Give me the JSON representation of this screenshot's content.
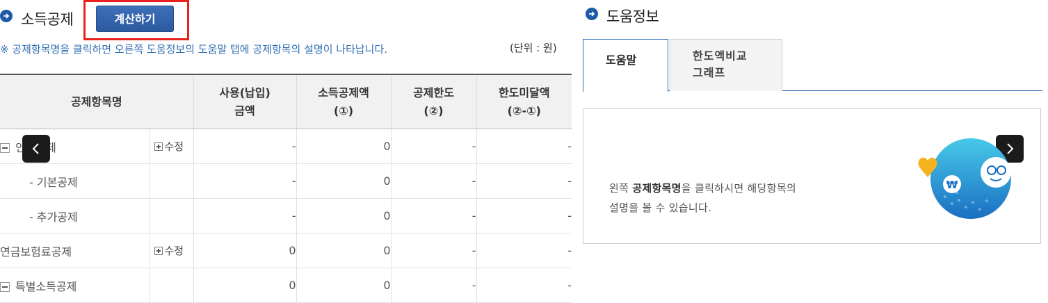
{
  "left": {
    "title": "소득공제",
    "calc_button": "계산하기",
    "notice": "※ 공제항목명을 클릭하면 오른쪽 도움정보의 도움말 탭에 공제항목의 설명이 나타납니다.",
    "unit": "(단위 : 원)",
    "table": {
      "headers": [
        "공제항목명",
        "사용(납입)\n금액",
        "소득공제액\n(①)",
        "공제한도\n(②)",
        "한도미달액\n(②-①)"
      ],
      "rows": [
        {
          "name": "인적공제",
          "edit": "수정",
          "used": "-",
          "deduct": "0",
          "limit": "-",
          "short": "-"
        },
        {
          "name": "- 기본공제",
          "edit": "",
          "used": "-",
          "deduct": "0",
          "limit": "-",
          "short": "-"
        },
        {
          "name": "- 추가공제",
          "edit": "",
          "used": "-",
          "deduct": "0",
          "limit": "-",
          "short": "-"
        },
        {
          "name": "연금보험료공제",
          "edit": "수정",
          "used": "0",
          "deduct": "0",
          "limit": "-",
          "short": "-"
        },
        {
          "name": "특별소득공제",
          "edit": "",
          "used": "0",
          "deduct": "0",
          "limit": "-",
          "short": "-"
        }
      ]
    }
  },
  "right": {
    "title": "도움정보",
    "tabs": [
      {
        "label": "도움말"
      },
      {
        "label": "한도액비교\n그래프"
      }
    ],
    "help_text_prefix": "왼쪽 ",
    "help_text_bold": "공제항목명",
    "help_text_mid": "을 클릭하시면 해당항목의",
    "help_text_line2": "설명을 볼 수 있습니다."
  },
  "colors": {
    "accent": "#2d6db3",
    "button": "#2b5aa0",
    "highlight": "#e8201f"
  },
  "icons": [
    "circle-arrow-icon",
    "chevron-left-icon",
    "chevron-right-icon",
    "minus-toggle-icon",
    "plus-box-icon",
    "mascot-illustration"
  ]
}
